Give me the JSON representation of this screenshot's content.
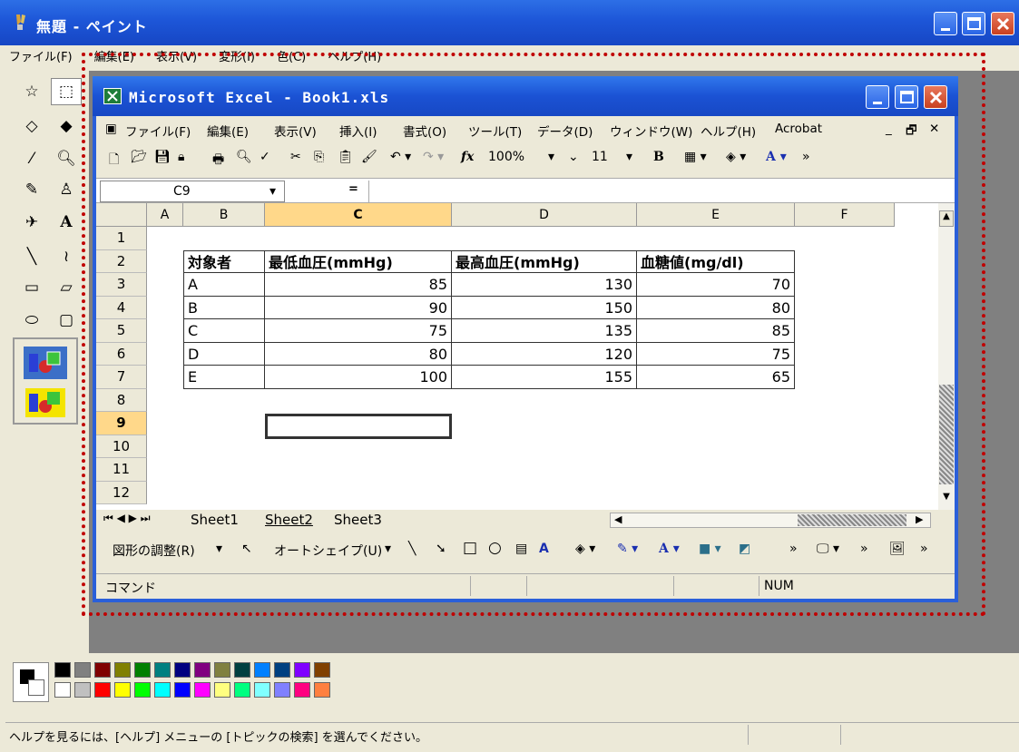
{
  "paint": {
    "title": "無題 - ペイント",
    "menu": [
      "ファイル(F)",
      "編集(E)",
      "表示(V)",
      "変形(I)",
      "色(C)",
      "ヘルプ(H)"
    ],
    "status": "ヘルプを見るには、[ヘルプ] メニューの [トピックの検索] を選んでください。"
  },
  "excel": {
    "title": "Microsoft Excel - Book1.xls",
    "menu": [
      "ファイル(F)",
      "編集(E)",
      "表示(V)",
      "挿入(I)",
      "書式(O)",
      "ツール(T)",
      "データ(D)",
      "ウィンドウ(W)",
      "ヘルプ(H)",
      "Acrobat"
    ],
    "zoom": "100%",
    "font_size": "11",
    "name_box": "C9",
    "formula_eq": "=",
    "columns": [
      "A",
      "B",
      "C",
      "D",
      "E",
      "F"
    ],
    "rows": [
      "1",
      "2",
      "3",
      "4",
      "5",
      "6",
      "7",
      "8",
      "9",
      "10",
      "11",
      "12"
    ],
    "table": {
      "headers": [
        "対象者",
        "最低血圧(mmHg)",
        "最高血圧(mmHg)",
        "血糖値(mg/dl)"
      ],
      "data": [
        [
          "A",
          "85",
          "130",
          "70"
        ],
        [
          "B",
          "90",
          "150",
          "80"
        ],
        [
          "C",
          "75",
          "135",
          "85"
        ],
        [
          "D",
          "80",
          "120",
          "75"
        ],
        [
          "E",
          "100",
          "155",
          "65"
        ]
      ]
    },
    "sheets": [
      "Sheet1",
      "Sheet2",
      "Sheet3"
    ],
    "drawbar": {
      "adjust": "図形の調整(R)",
      "autoshape": "オートシェイプ(U)"
    },
    "status": "コマンド",
    "status_num": "NUM"
  },
  "colors": {
    "selection_frame": "#c00000",
    "title_blue": "#1d56d8"
  }
}
